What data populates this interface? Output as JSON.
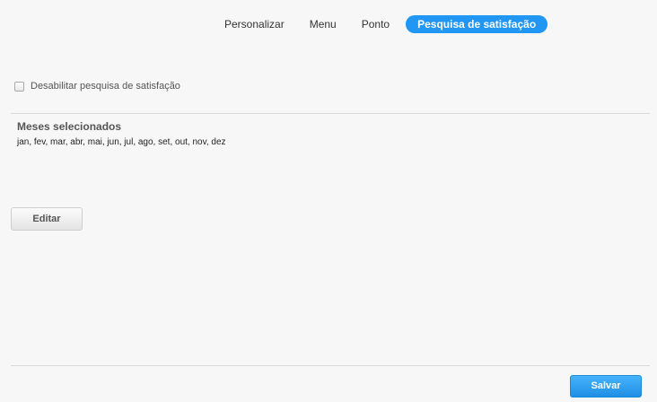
{
  "tabs": [
    {
      "label": "Personalizar",
      "active": false
    },
    {
      "label": "Menu",
      "active": false
    },
    {
      "label": "Ponto",
      "active": false
    },
    {
      "label": "Pesquisa de satisfação",
      "active": true
    }
  ],
  "disable_survey": {
    "label": "Desabilitar pesquisa de satisfação",
    "checked": false
  },
  "months": {
    "title": "Meses selecionados",
    "list": "jan, fev, mar, abr, mai, jun, jul, ago, set, out, nov, dez"
  },
  "buttons": {
    "edit_label": "Editar",
    "save_label": "Salvar"
  },
  "colors": {
    "accent": "#2196f3",
    "background": "#f7f7f7"
  }
}
